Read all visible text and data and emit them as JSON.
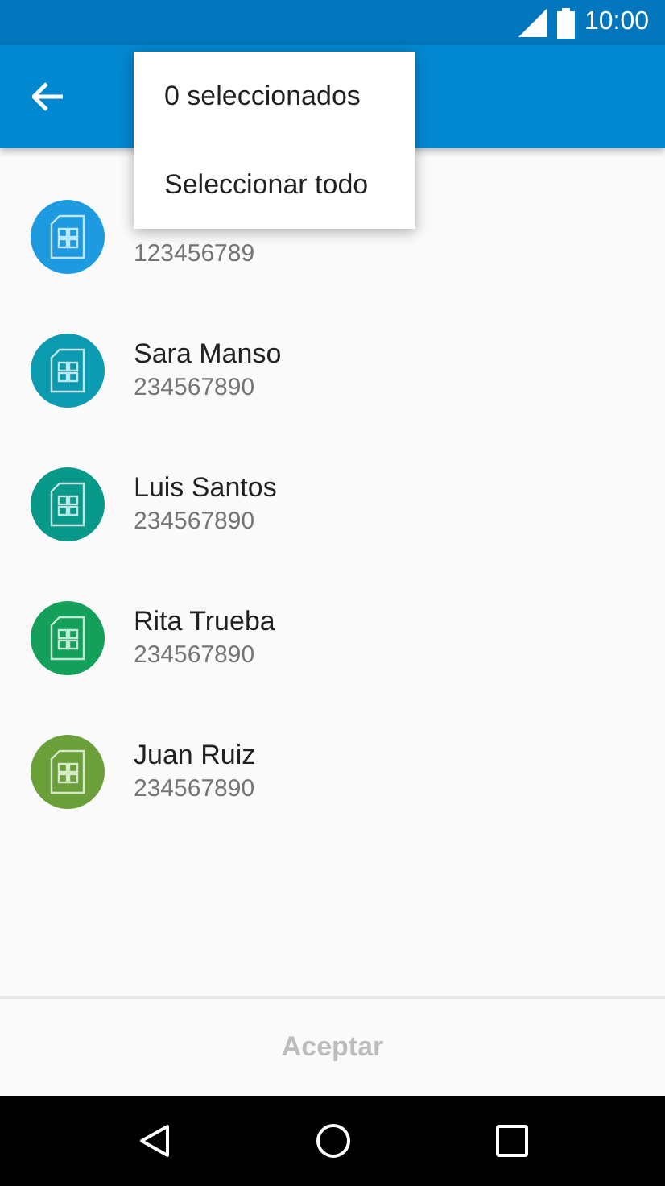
{
  "status_bar": {
    "time": "10:00"
  },
  "menu": {
    "items": [
      {
        "label": "0 seleccionados"
      },
      {
        "label": "Seleccionar todo"
      }
    ]
  },
  "contacts": [
    {
      "number": "123456789",
      "color": "#1e9be0"
    },
    {
      "name": "Sara Manso",
      "number": "234567890",
      "color": "#0a9bb0"
    },
    {
      "name": "Luis Santos",
      "number": "234567890",
      "color": "#08998a"
    },
    {
      "name": "Rita Trueba",
      "number": "234567890",
      "color": "#14a05a"
    },
    {
      "name": "Juan Ruiz",
      "number": "234567890",
      "color": "#6a9f3a"
    }
  ],
  "footer": {
    "button": {
      "label": "Aceptar",
      "disabled": true
    }
  }
}
